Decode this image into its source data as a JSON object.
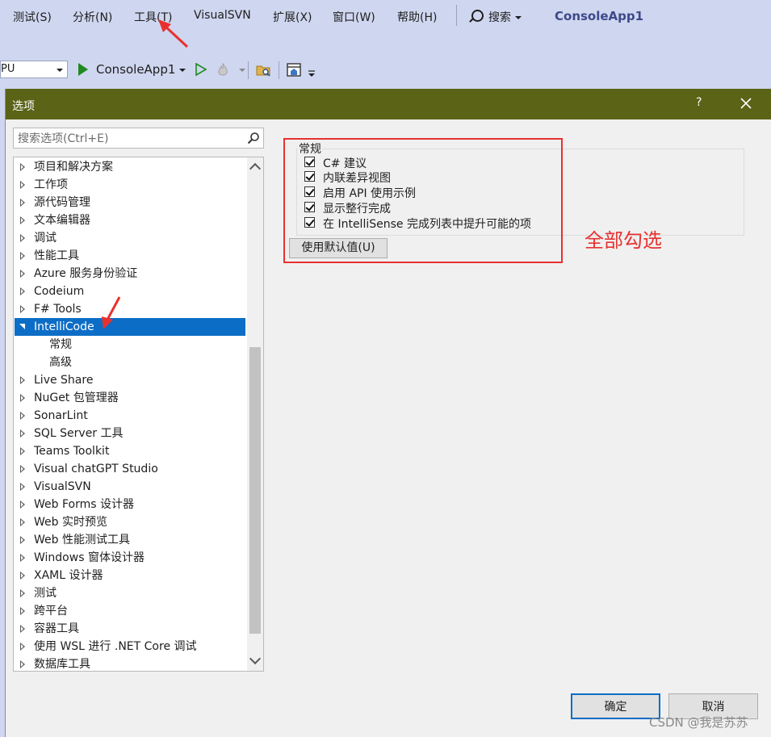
{
  "menubar": {
    "items": [
      "测试(S)",
      "分析(N)",
      "工具(T)",
      "VisualSVN",
      "扩展(X)",
      "窗口(W)",
      "帮助(H)"
    ],
    "search_label": "搜索",
    "app_title": "ConsoleApp1"
  },
  "toolbar": {
    "platform_combo": "PU",
    "run_target": "ConsoleApp1"
  },
  "dialog": {
    "title": "选项",
    "help": "?",
    "search_placeholder": "搜索选项(Ctrl+E)",
    "tree": [
      {
        "label": "项目和解决方案",
        "state": "collapsed"
      },
      {
        "label": "工作项",
        "state": "collapsed"
      },
      {
        "label": "源代码管理",
        "state": "collapsed"
      },
      {
        "label": "文本编辑器",
        "state": "collapsed"
      },
      {
        "label": "调试",
        "state": "collapsed"
      },
      {
        "label": "性能工具",
        "state": "collapsed"
      },
      {
        "label": "Azure 服务身份验证",
        "state": "collapsed"
      },
      {
        "label": "Codeium",
        "state": "collapsed"
      },
      {
        "label": "F# Tools",
        "state": "collapsed"
      },
      {
        "label": "IntelliCode",
        "state": "expanded",
        "selected": true
      },
      {
        "label": "常规",
        "state": "child"
      },
      {
        "label": "高级",
        "state": "child"
      },
      {
        "label": "Live Share",
        "state": "collapsed"
      },
      {
        "label": "NuGet 包管理器",
        "state": "collapsed"
      },
      {
        "label": "SonarLint",
        "state": "collapsed"
      },
      {
        "label": "SQL Server 工具",
        "state": "collapsed"
      },
      {
        "label": "Teams Toolkit",
        "state": "collapsed"
      },
      {
        "label": "Visual chatGPT Studio",
        "state": "collapsed"
      },
      {
        "label": "VisualSVN",
        "state": "collapsed"
      },
      {
        "label": "Web Forms 设计器",
        "state": "collapsed"
      },
      {
        "label": "Web 实时预览",
        "state": "collapsed"
      },
      {
        "label": "Web 性能测试工具",
        "state": "collapsed"
      },
      {
        "label": "Windows 窗体设计器",
        "state": "collapsed"
      },
      {
        "label": "XAML 设计器",
        "state": "collapsed"
      },
      {
        "label": "测试",
        "state": "collapsed"
      },
      {
        "label": "跨平台",
        "state": "collapsed"
      },
      {
        "label": "容器工具",
        "state": "collapsed"
      },
      {
        "label": "使用 WSL 进行 .NET Core 调试",
        "state": "collapsed"
      },
      {
        "label": "数据库工具",
        "state": "collapsed"
      }
    ],
    "group_label": "常规",
    "checkboxes": [
      {
        "label": "C# 建议",
        "checked": true
      },
      {
        "label": "内联差异视图",
        "checked": true
      },
      {
        "label": "启用 API 使用示例",
        "checked": true
      },
      {
        "label": "显示整行完成",
        "checked": true
      },
      {
        "label": "在 IntelliSense 完成列表中提升可能的项",
        "checked": true
      }
    ],
    "defaults_button": "使用默认值(U)",
    "ok_button": "确定",
    "cancel_button": "取消"
  },
  "annotation": {
    "text": "全部勾选",
    "color": "#e8312f"
  },
  "watermark": "CSDN @我是苏苏",
  "colors": {
    "titlebar": "#5a6316",
    "selection": "#0c6dc6",
    "ide_chrome": "#cfd6ef"
  }
}
